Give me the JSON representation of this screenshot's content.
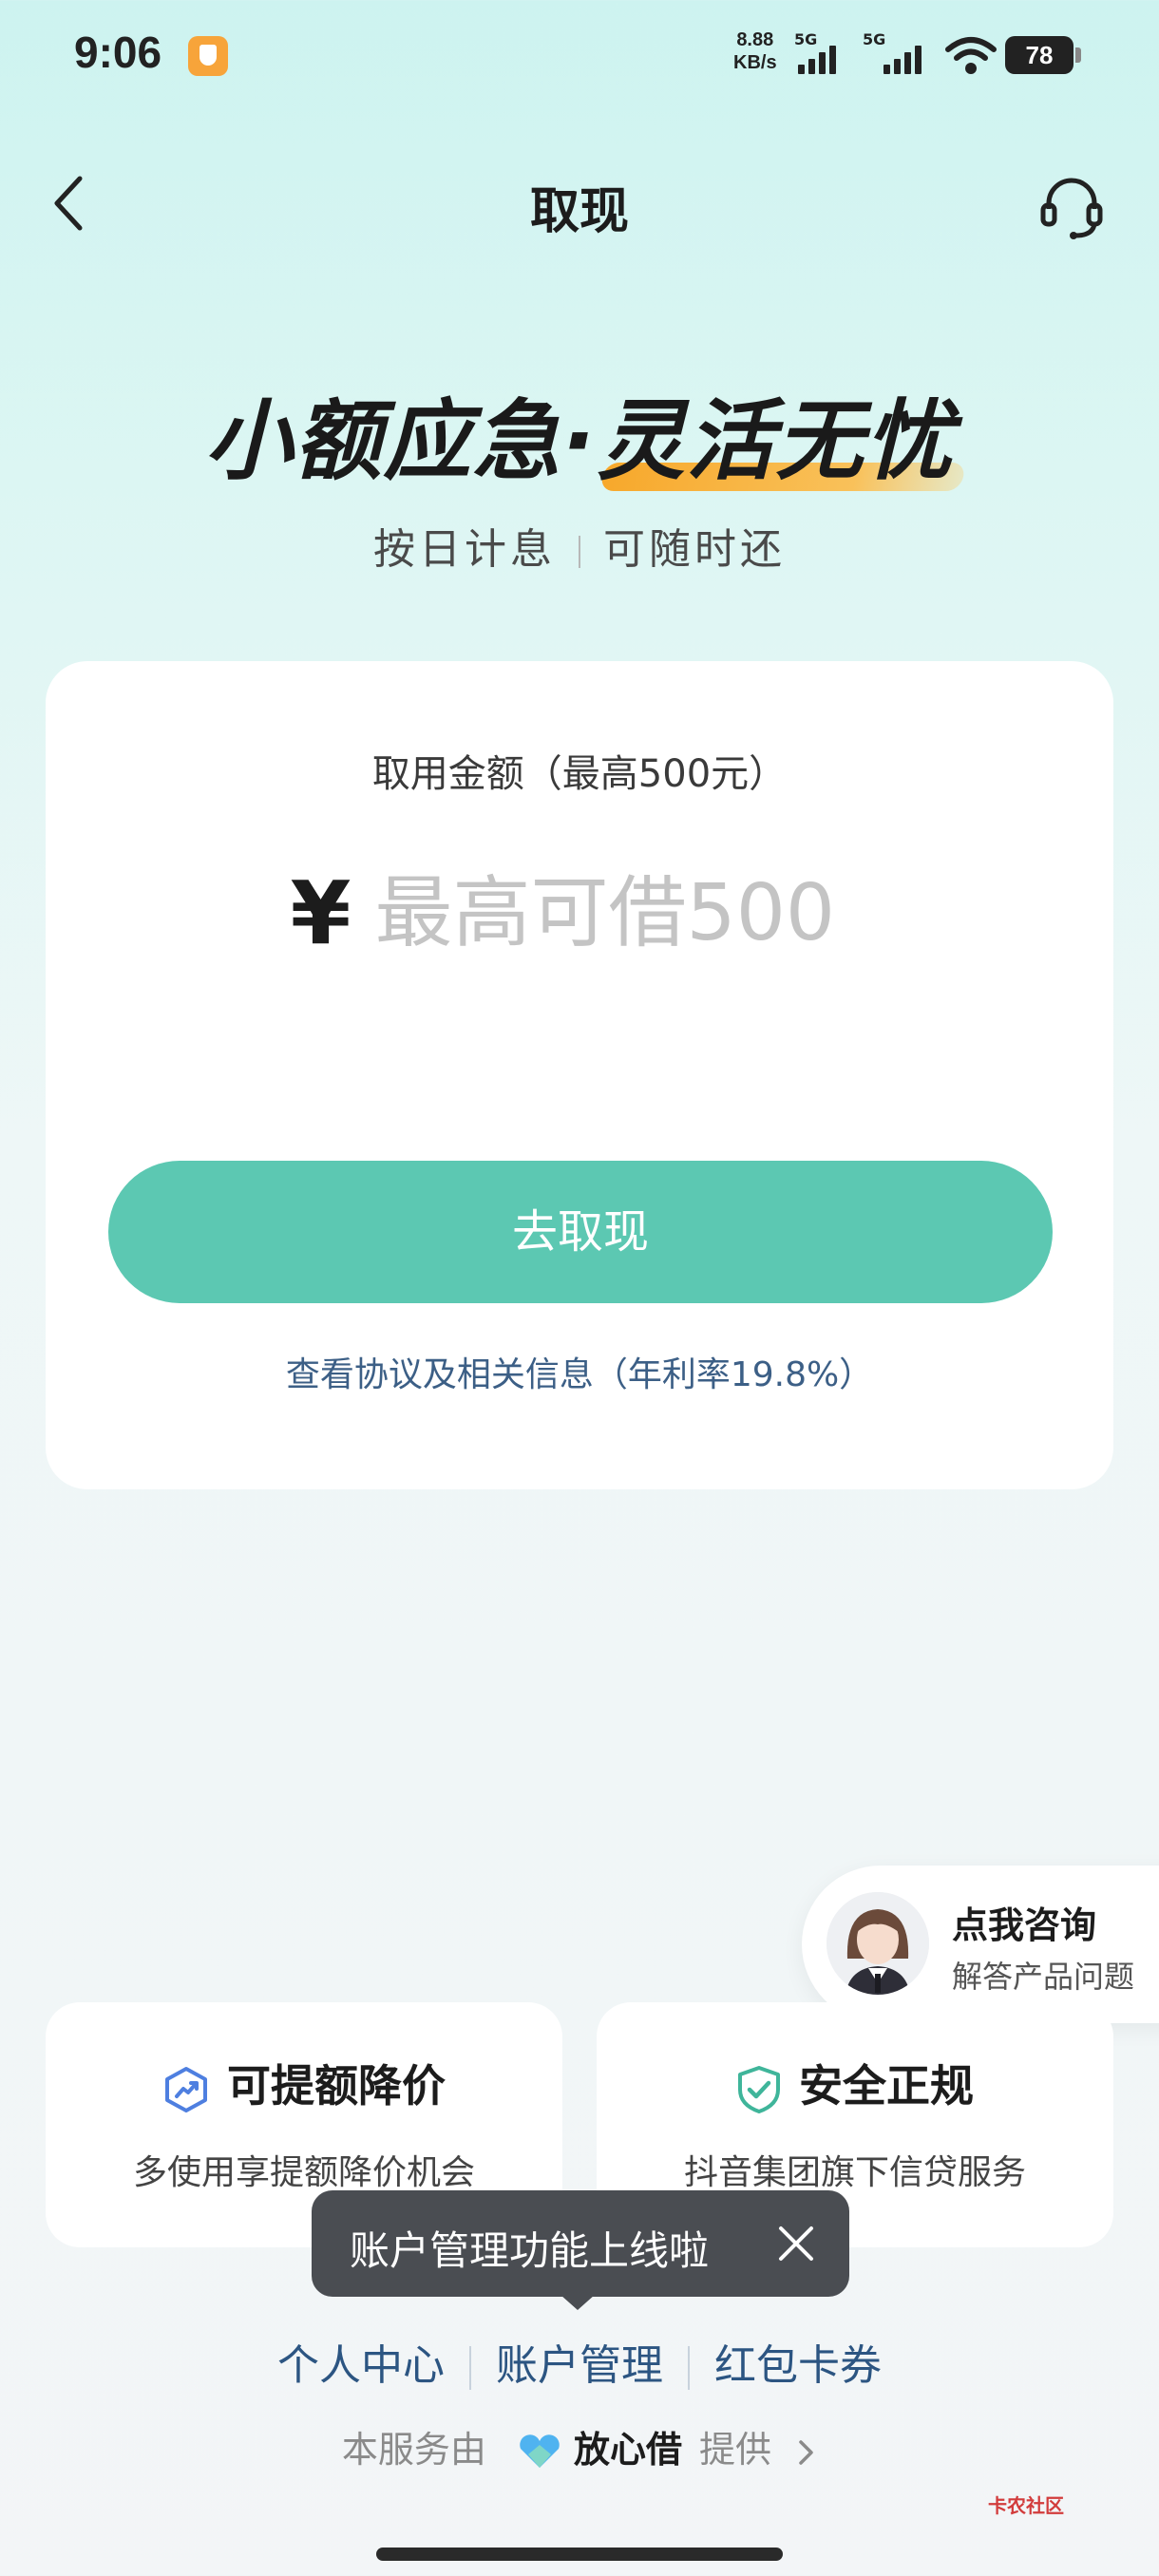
{
  "status_bar": {
    "time": "9:06",
    "net_speed_value": "8.88",
    "net_speed_unit": "KB/s",
    "signal_1": "5G",
    "signal_2": "5G",
    "battery": "78"
  },
  "header": {
    "title": "取现"
  },
  "banner": {
    "slogan_part1": "小额应急·",
    "slogan_part2": "灵活无忧",
    "sub_left": "按日计息",
    "sub_right": "可随时还"
  },
  "card": {
    "amount_label": "取用金额（最高500元）",
    "currency_symbol": "¥",
    "amount_placeholder": "最高可借500",
    "withdraw_button": "去取现",
    "agreement_link": "查看协议及相关信息（年利率19.8%）"
  },
  "consult": {
    "title": "点我咨询",
    "subtitle": "解答产品问题"
  },
  "features": [
    {
      "title": "可提额降价",
      "desc": "多使用享提额降价机会",
      "icon": "trend-up-icon",
      "color": "#4e7fe0"
    },
    {
      "title": "安全正规",
      "desc": "抖音集团旗下信贷服务",
      "icon": "shield-check-icon",
      "color": "#3fb59a"
    }
  ],
  "toast": {
    "text": "账户管理功能上线啦"
  },
  "footer_links": [
    "个人中心",
    "账户管理",
    "红包卡券"
  ],
  "provider": {
    "prefix": "本服务由",
    "brand": "放心借",
    "suffix": "提供"
  },
  "watermark": "卡农社区",
  "colors": {
    "primary_button": "#5cc8b2",
    "link": "#2c5582",
    "accent_highlight": "#f7a82b"
  }
}
